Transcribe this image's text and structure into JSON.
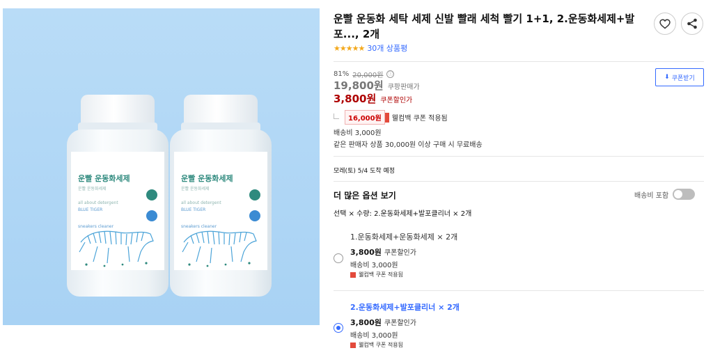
{
  "product": {
    "title": "운빨 운동화 세탁 세제 신발 빨래 세척 빨기 1+1, 2.운동화세제+발포..., 2개",
    "rating_stars": "★★★★★",
    "review_link": "30개 상품평"
  },
  "image": {
    "brand": "운빨 운동화세제",
    "sub_kor": "운빨 운동화세제",
    "sub1": "all about detergent",
    "sub2": "BLUE TIGER",
    "sub3": "sneakers cleaner"
  },
  "pricing": {
    "discount_rate": "81%",
    "original_price": "20,000원",
    "info_icon": "ⓘ",
    "sale_price": "19,800원",
    "sale_label": "쿠팡판매가",
    "coupon_price": "3,800원",
    "coupon_label": "쿠폰할인가",
    "coupon_button": "쿠폰받기",
    "cashback_amount": "16,000원",
    "cashback_text": "웰컴백 쿠폰 적용됨"
  },
  "shipping": {
    "fee": "배송비 3,000원",
    "free_condition": "같은 판매자 상품 30,000원 이상 구매 시 무료배송",
    "arrival": "모레(토) 5/4 도착 예정"
  },
  "options": {
    "more_title": "더 많은 옵션 보기",
    "shipping_toggle_label": "배송비 포함",
    "selection_summary": "선택 × 수량: 2.운동화세제+발포클리너 × 2개",
    "items": [
      {
        "name": "1.운동화세제+운동화세제 × 2개",
        "price": "3,800원",
        "price_label": "쿠폰할인가",
        "ship": "배송비 3,000원",
        "coupon": "웰컴백 쿠폰 적용됨",
        "selected": false
      },
      {
        "name": "2.운동화세제+발포클리너 × 2개",
        "price": "3,800원",
        "price_label": "쿠폰할인가",
        "ship": "배송비 3,000원",
        "coupon": "웰컴백 쿠폰 적용됨",
        "selected": true
      }
    ]
  },
  "colors": {
    "accent_blue": "#346aff",
    "coupon_red": "#ae0000",
    "star_orange": "#f3a81b"
  },
  "icons": {
    "wishlist": "heart-icon",
    "share": "share-icon"
  }
}
